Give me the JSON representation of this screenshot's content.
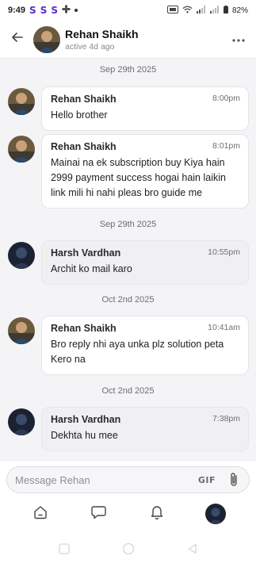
{
  "status_bar": {
    "time": "9:49",
    "app_icons": [
      "S",
      "S",
      "S"
    ],
    "battery": "82%"
  },
  "header": {
    "name": "Rehan Shaikh",
    "status": "active 4d ago"
  },
  "messages": [
    {
      "type": "date",
      "text": "Sep 29th 2025"
    },
    {
      "type": "message",
      "sender": "Rehan Shaikh",
      "time": "8:00pm",
      "text": "Hello brother"
    },
    {
      "type": "message",
      "sender": "Rehan Shaikh",
      "time": "8:01pm",
      "text": "Mainai na ek subscription buy Kiya hain 2999 payment success hogai hain laikin link mili hi nahi pleas bro guide me"
    },
    {
      "type": "date",
      "text": "Sep 29th 2025"
    },
    {
      "type": "message",
      "sender": "Harsh Vardhan",
      "time": "10:55pm",
      "text": "Archit ko mail karo"
    },
    {
      "type": "date",
      "text": "Oct 2nd 2025"
    },
    {
      "type": "message",
      "sender": "Rehan Shaikh",
      "time": "10:41am",
      "text": "Bro reply nhi aya unka plz solution peta Kero na"
    },
    {
      "type": "date",
      "text": "Oct 2nd 2025"
    },
    {
      "type": "message",
      "sender": "Harsh Vardhan",
      "time": "7:38pm",
      "text": "Dekhta hu mee"
    }
  ],
  "composer": {
    "placeholder": "Message Rehan",
    "gif_label": "GIF"
  },
  "colors": {
    "accent": "#5b2bd1",
    "bubble_self": "#ffffff",
    "bubble_other": "#f0f0f2"
  },
  "icons": {
    "back": "arrow-left-icon",
    "more": "more-horizontal-icon",
    "attach": "paperclip-icon",
    "nav": [
      "home-icon",
      "chat-icon",
      "bell-icon",
      "profile-avatar"
    ]
  }
}
